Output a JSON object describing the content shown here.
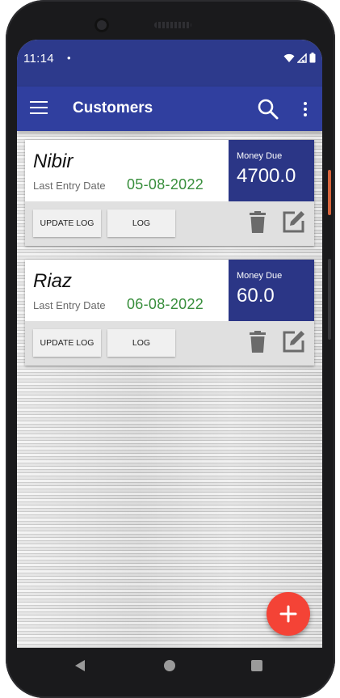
{
  "status_bar": {
    "time": "11:14",
    "dot": "•"
  },
  "app_bar": {
    "title": "Customers"
  },
  "customers": [
    {
      "name": "Nibir",
      "last_entry_label": "Last Entry Date",
      "last_entry_date": "05-08-2022",
      "money_due_label": "Money Due",
      "money_due": "4700.0",
      "update_log_label": "UPDATE LOG",
      "log_label": "LOG"
    },
    {
      "name": "Riaz",
      "last_entry_label": "Last Entry Date",
      "last_entry_date": "06-08-2022",
      "money_due_label": "Money Due",
      "money_due": "60.0",
      "update_log_label": "UPDATE LOG",
      "log_label": "LOG"
    }
  ],
  "colors": {
    "primary": "#303f9f",
    "status_bar": "#2d3a8c",
    "due_box": "#2b3686",
    "date_text": "#388e3c",
    "fab": "#f44336"
  },
  "icons": [
    "menu-icon",
    "search-icon",
    "more-vert-icon",
    "delete-icon",
    "edit-icon",
    "add-icon",
    "wifi-icon",
    "signal-icon",
    "battery-icon"
  ]
}
